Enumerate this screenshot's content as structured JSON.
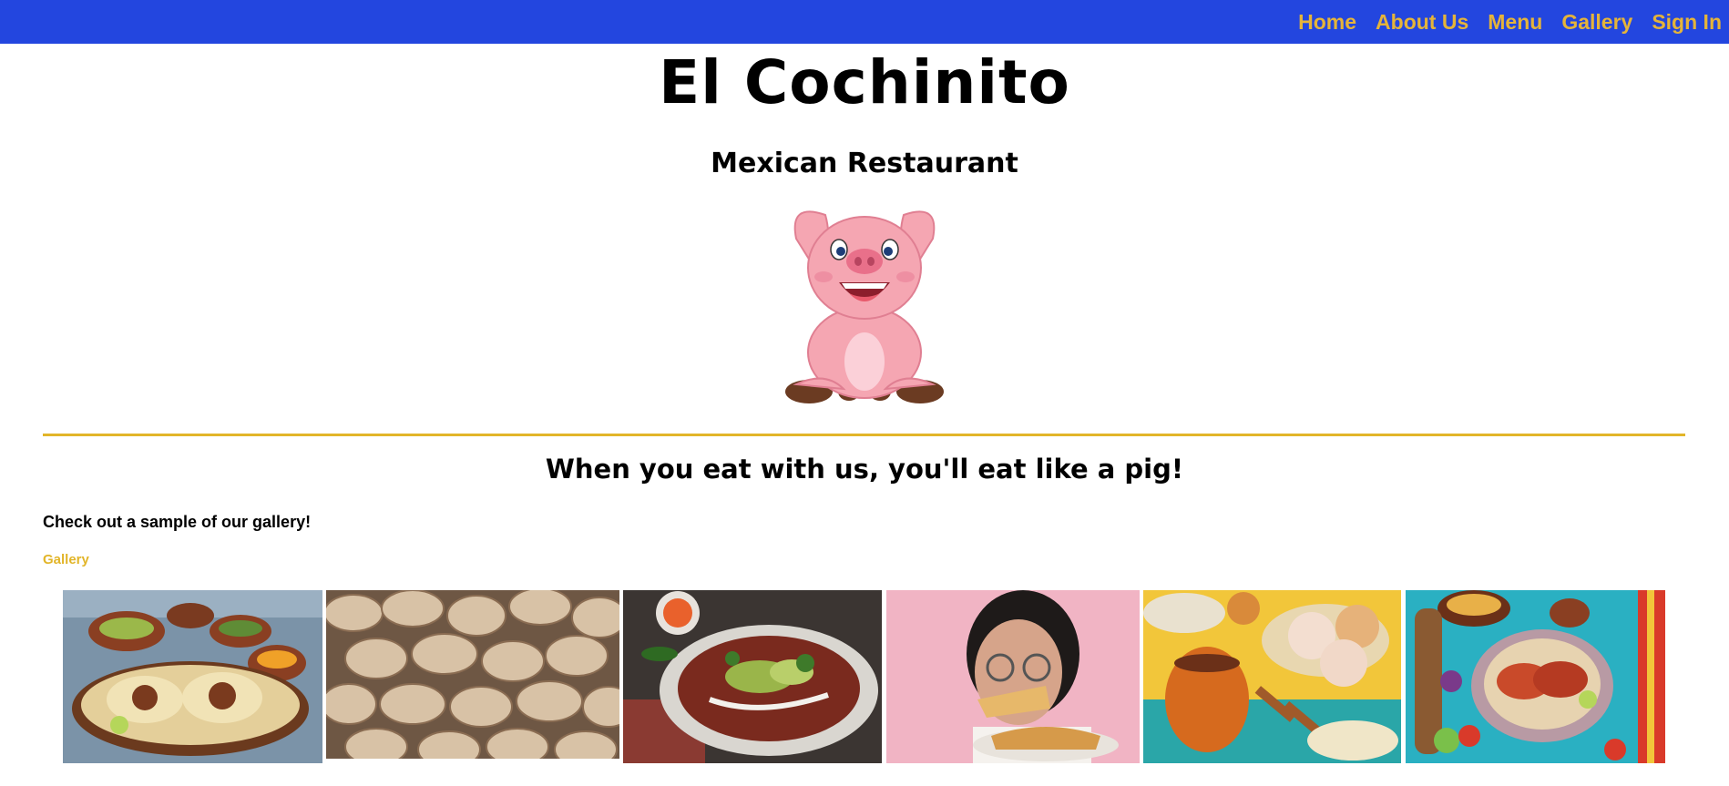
{
  "nav": {
    "items": [
      {
        "label": "Home"
      },
      {
        "label": "About Us"
      },
      {
        "label": "Menu"
      },
      {
        "label": "Gallery"
      },
      {
        "label": "Sign In"
      }
    ]
  },
  "header": {
    "title": "El Cochinito",
    "subtitle": "Mexican Restaurant",
    "logo_icon": "cartoon-pig-icon"
  },
  "main": {
    "tagline": "When you eat with us, you'll eat like a pig!",
    "gallery_intro": "Check out a sample of our gallery!",
    "gallery_link": "Gallery",
    "photos": [
      {
        "subject": "tacos-with-salsas"
      },
      {
        "subject": "bread-rolls"
      },
      {
        "subject": "enchiladas-plate"
      },
      {
        "subject": "woman-eating-taco"
      },
      {
        "subject": "pan-dulce-and-hot-chocolate"
      },
      {
        "subject": "tacos-on-colorful-table"
      }
    ]
  },
  "colors": {
    "nav_background": "#2346df",
    "accent_gold": "#e2b529",
    "nav_link": "#e5b43a"
  }
}
